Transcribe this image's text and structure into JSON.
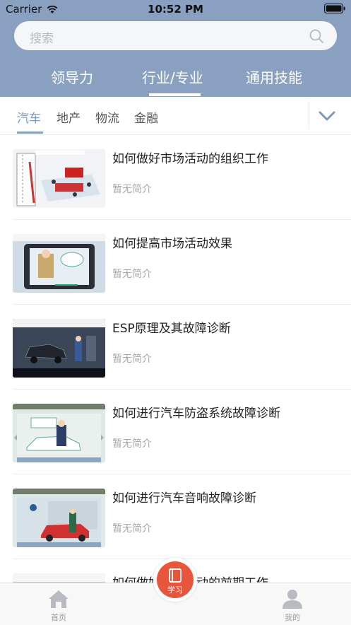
{
  "status_bar": {
    "carrier": "Carrier",
    "time": "10:52 PM"
  },
  "search": {
    "placeholder": "搜索"
  },
  "category_tabs": [
    {
      "label": "领导力"
    },
    {
      "label": "行业/专业",
      "active": true
    },
    {
      "label": "通用技能"
    }
  ],
  "sub_tabs": [
    {
      "label": "汽车",
      "active": true
    },
    {
      "label": "地产"
    },
    {
      "label": "物流"
    },
    {
      "label": "金融"
    }
  ],
  "courses": [
    {
      "title": "如何做好市场活动的组织工作",
      "description": "暂无简介"
    },
    {
      "title": "如何提高市场活动效果",
      "description": "暂无简介"
    },
    {
      "title": "ESP原理及其故障诊断",
      "description": "暂无简介"
    },
    {
      "title": "如何进行汽车防盗系统故障诊断",
      "description": "暂无简介"
    },
    {
      "title": "如何进行汽车音响故障诊断",
      "description": "暂无简介"
    },
    {
      "title": "如何做好市场活动的前期工作",
      "description": ""
    }
  ],
  "tab_bar": {
    "home": "首页",
    "study": "学习",
    "mine": "我的"
  },
  "colors": {
    "header": "#8aa0c0",
    "accent": "#e9553a",
    "active_sub_tab": "#7f99bd"
  },
  "icons": [
    "wifi-icon",
    "battery-icon",
    "search-icon",
    "chevron-down-icon",
    "home-icon",
    "book-icon",
    "user-icon"
  ]
}
